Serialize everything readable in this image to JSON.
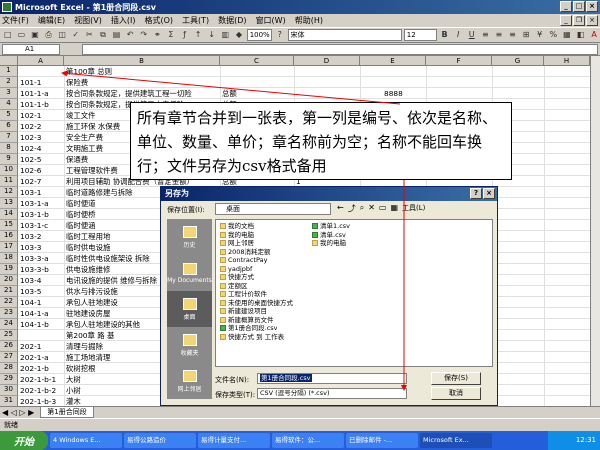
{
  "window": {
    "title": "Microsoft Excel - 第1册合同段.csv"
  },
  "menu": [
    "文件(F)",
    "编辑(E)",
    "视图(V)",
    "插入(I)",
    "格式(O)",
    "工具(T)",
    "数据(D)",
    "窗口(W)",
    "帮助(H)"
  ],
  "toolbar": {
    "font": "宋体",
    "size": "12",
    "zoom": "100%"
  },
  "formula": {
    "cell_ref": "A1"
  },
  "grid": {
    "columns": [
      "A",
      "B",
      "C",
      "D",
      "E",
      "F",
      "G",
      "H"
    ],
    "rows": [
      {
        "n": "1",
        "a": "",
        "b": "第100章  总则",
        "c": "",
        "d": "",
        "e": ""
      },
      {
        "n": "2",
        "a": "101-1",
        "b": "保险费",
        "c": "",
        "d": "",
        "e": ""
      },
      {
        "n": "3",
        "a": "101-1-a",
        "b": "按合同条款规定，提供建筑工程一切险",
        "c": "总额",
        "d": "",
        "e": "8888"
      },
      {
        "n": "4",
        "a": "101-1-b",
        "b": "按合同条款规定，提供第三方责任险",
        "c": "总额",
        "d": "",
        "e": "8888"
      },
      {
        "n": "5",
        "a": "102-1",
        "b": "竣工文件",
        "c": "",
        "d": "",
        "e": ""
      },
      {
        "n": "6",
        "a": "102-2",
        "b": "施工环保  水保费",
        "c": "",
        "d": "",
        "e": ""
      },
      {
        "n": "7",
        "a": "102-3",
        "b": "安全生产费",
        "c": "",
        "d": "",
        "e": ""
      },
      {
        "n": "8",
        "a": "102-4",
        "b": "文明施工费",
        "c": "",
        "d": "",
        "e": ""
      },
      {
        "n": "9",
        "a": "102-5",
        "b": "保通费",
        "c": "",
        "d": "",
        "e": ""
      },
      {
        "n": "10",
        "a": "102-6",
        "b": "工程管理软件费",
        "c": "",
        "d": "",
        "e": ""
      },
      {
        "n": "11",
        "a": "102-7",
        "b": "利用项目辅助  协调配合费（暂定金额）",
        "c": "总额",
        "d": "1",
        "e": ""
      },
      {
        "n": "12",
        "a": "103-1",
        "b": "临时道路修建与拆除",
        "c": "",
        "d": "",
        "e": ""
      },
      {
        "n": "13",
        "a": "103-1-a",
        "b": "临时便道",
        "c": "",
        "d": "",
        "e": ""
      },
      {
        "n": "14",
        "a": "103-1-b",
        "b": "临时便桥",
        "c": "",
        "d": "",
        "e": ""
      },
      {
        "n": "15",
        "a": "103-1-c",
        "b": "临时便涵",
        "c": "",
        "d": "",
        "e": ""
      },
      {
        "n": "16",
        "a": "103-2",
        "b": "临时工程用地",
        "c": "",
        "d": "",
        "e": ""
      },
      {
        "n": "17",
        "a": "103-3",
        "b": "临时供电设施",
        "c": "",
        "d": "",
        "e": ""
      },
      {
        "n": "18",
        "a": "103-3-a",
        "b": "临时性供电设施架设  拆除",
        "c": "",
        "d": "",
        "e": ""
      },
      {
        "n": "19",
        "a": "103-3-b",
        "b": "供电设施维修",
        "c": "",
        "d": "",
        "e": ""
      },
      {
        "n": "20",
        "a": "103-4",
        "b": "电讯设施的提供  维修与拆除",
        "c": "",
        "d": "",
        "e": ""
      },
      {
        "n": "21",
        "a": "103-5",
        "b": "供水与排污设施",
        "c": "",
        "d": "",
        "e": ""
      },
      {
        "n": "22",
        "a": "104-1",
        "b": "承包人驻地建设",
        "c": "",
        "d": "",
        "e": ""
      },
      {
        "n": "23",
        "a": "104-1-a",
        "b": "驻地建设房屋",
        "c": "",
        "d": "",
        "e": ""
      },
      {
        "n": "24",
        "a": "104-1-b",
        "b": "承包人驻地建设的其他",
        "c": "",
        "d": "",
        "e": ""
      },
      {
        "n": "25",
        "a": "",
        "b": "第200章    路  基",
        "c": "",
        "d": "",
        "e": ""
      },
      {
        "n": "26",
        "a": "202-1",
        "b": "清理与掘除",
        "c": "",
        "d": "",
        "e": ""
      },
      {
        "n": "27",
        "a": "202-1-a",
        "b": "施工场地清理",
        "c": "",
        "d": "",
        "e": ""
      },
      {
        "n": "28",
        "a": "202-1-b",
        "b": "砍树挖根",
        "c": "",
        "d": "",
        "e": ""
      },
      {
        "n": "29",
        "a": "202-1-b-1",
        "b": "大树",
        "c": "",
        "d": "",
        "e": ""
      },
      {
        "n": "30",
        "a": "202-1-b-2",
        "b": "小树",
        "c": "",
        "d": "",
        "e": ""
      },
      {
        "n": "31",
        "a": "202-1-b-3",
        "b": "灌木",
        "c": "",
        "d": "",
        "e": ""
      }
    ]
  },
  "sheet_tab": "第1册合同段",
  "status": "就绪",
  "annotation": "所有章节合并到一张表，第一列是编号、依次是名称、单位、数量、单价；章名称前为空；名称不能回车换行；文件另存为csv格式备用",
  "dialog": {
    "title": "另存为",
    "look_in_label": "保存位置(I):",
    "look_in_value": "桌面",
    "tools_label": "工具(L)",
    "places": [
      "历史",
      "My Documents",
      "桌面",
      "收藏夹",
      "网上邻居"
    ],
    "files_col1": [
      "我的文档",
      "我的电脑",
      "网上邻居",
      "2008消耗定额",
      "ContractPay",
      "yadjpbf",
      "快捷方式",
      "定额区",
      "工程计价软件",
      "未使用的桌面快捷方式",
      "新建建设项目",
      "新建概算员文件",
      "第1册合同段.csv",
      "快捷方式 到 工作表"
    ],
    "files_col2": [
      "清单1.csv",
      "清单.csv",
      "我的电脑"
    ],
    "filename_label": "文件名(N):",
    "filename_value": "第1册合同段.csv",
    "filetype_label": "保存类型(T):",
    "filetype_value": "CSV (逗号分隔) (*.csv)",
    "save_btn": "保存(S)",
    "cancel_btn": "取消"
  },
  "taskbar": {
    "start": "开始",
    "items": [
      "4 Windows E...",
      "易得公路造价",
      "易得计量支付...",
      "易得软件：公...",
      "已删除邮件 -...",
      "Microsoft Ex..."
    ],
    "clock": "12:31"
  }
}
